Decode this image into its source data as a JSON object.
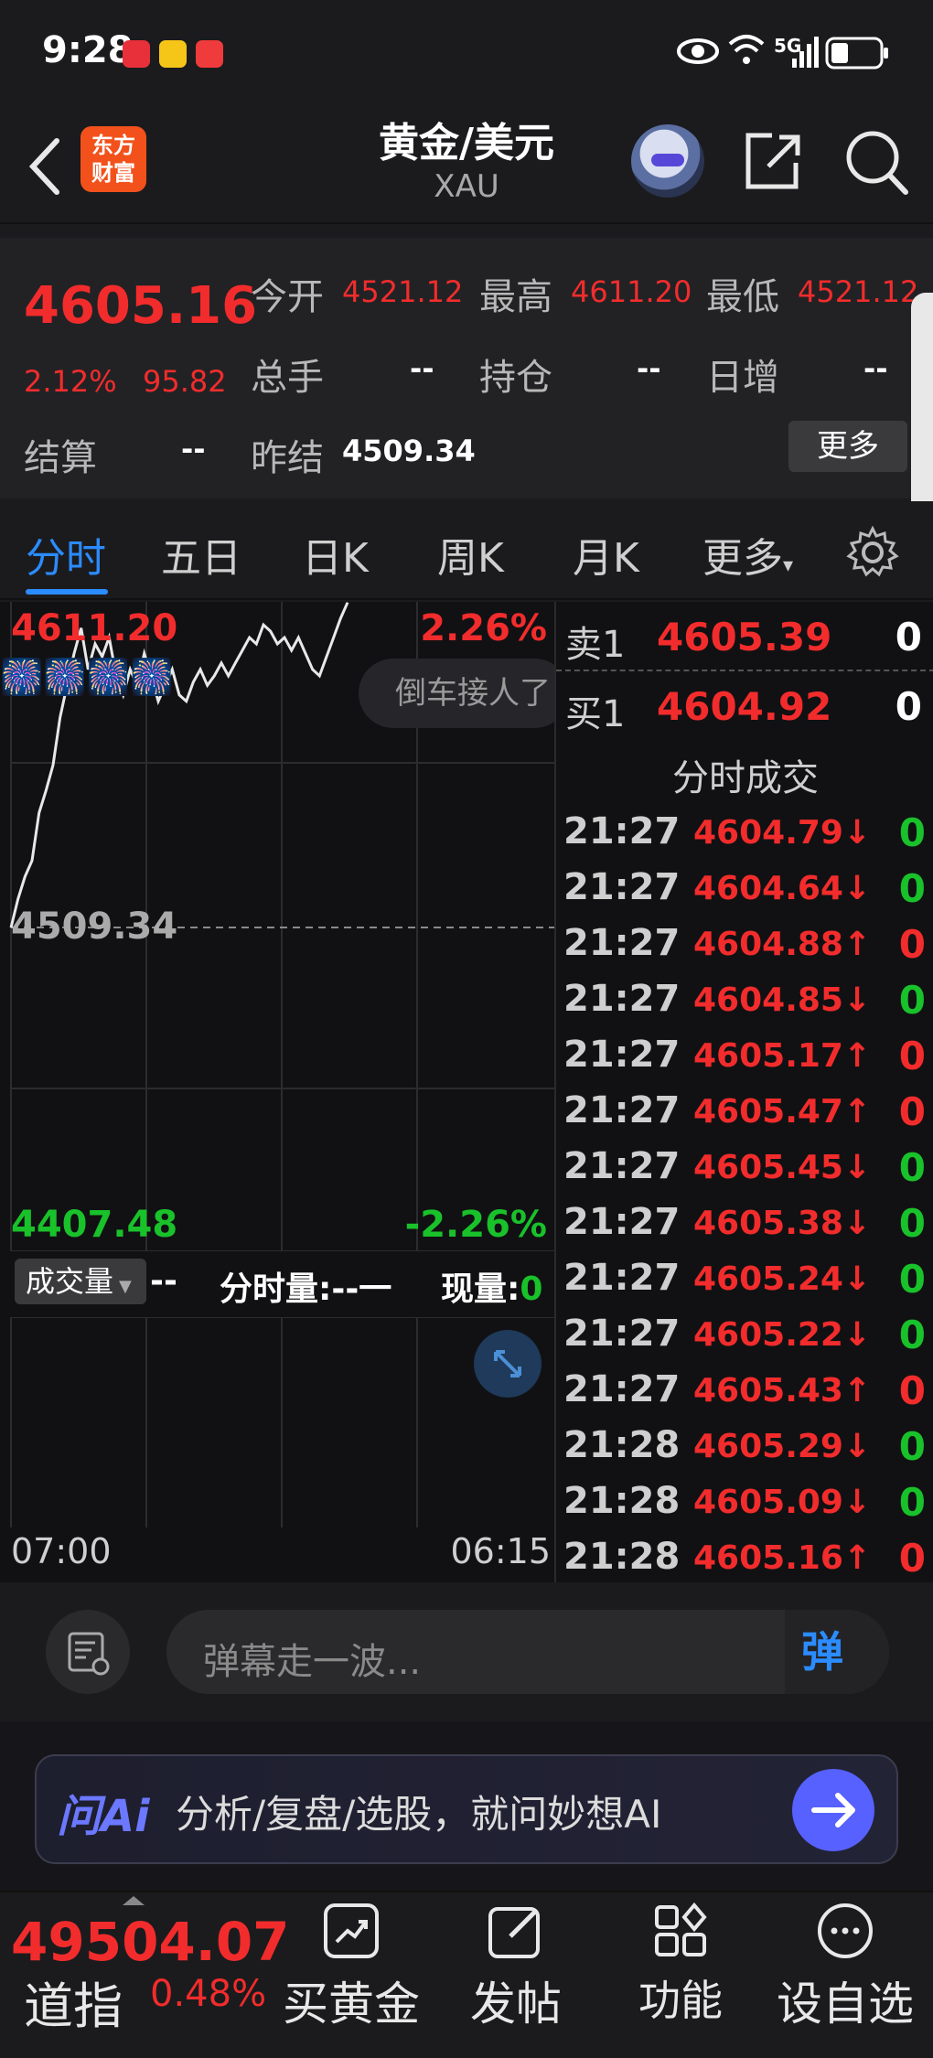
{
  "status": {
    "time": "9:28",
    "network": "5G"
  },
  "header": {
    "logo_line1": "东方",
    "logo_line2": "财富",
    "title": "黄金/美元",
    "subtitle": "XAU"
  },
  "quote": {
    "price": "4605.16",
    "change_pct": "2.12%",
    "change_abs": "95.82",
    "fields": {
      "open_label": "今开",
      "open": "4521.12",
      "high_label": "最高",
      "high": "4611.20",
      "low_label": "最低",
      "low": "4521.12",
      "volume_label": "总手",
      "volume": "--",
      "position_label": "持仓",
      "position": "--",
      "daily_inc_label": "日增",
      "daily_inc": "--",
      "settle_label": "结算",
      "settle": "--",
      "prev_settle_label": "昨结",
      "prev_settle": "4509.34"
    },
    "more_label": "更多"
  },
  "tabs": [
    "分时",
    "五日",
    "日K",
    "周K",
    "月K",
    "更多"
  ],
  "chart": {
    "top_price": "4611.20",
    "top_pct": "2.26%",
    "mid_price": "4509.34",
    "bottom_price": "4407.48",
    "bottom_pct": "-2.26%",
    "banner": "倒车接人了",
    "fireworks": "🎆🎆🎆🎆",
    "volume_selector": "成交量",
    "volume_value": "--",
    "tick_volume_label": "分时量:",
    "tick_volume_value": "--一",
    "current_volume_label": "现量:",
    "current_volume_value": "0",
    "time_start": "07:00",
    "time_end": "06:15"
  },
  "orderbook": {
    "ask_label": "卖1",
    "ask_price": "4605.39",
    "ask_vol": "0",
    "bid_label": "买1",
    "bid_price": "4604.92",
    "bid_vol": "0",
    "ticks_header": "分时成交",
    "ticks": [
      {
        "time": "21:27",
        "price": "4604.79↓",
        "vol": "0",
        "dir": "down"
      },
      {
        "time": "21:27",
        "price": "4604.64↓",
        "vol": "0",
        "dir": "down"
      },
      {
        "time": "21:27",
        "price": "4604.88↑",
        "vol": "0",
        "dir": "up"
      },
      {
        "time": "21:27",
        "price": "4604.85↓",
        "vol": "0",
        "dir": "down"
      },
      {
        "time": "21:27",
        "price": "4605.17↑",
        "vol": "0",
        "dir": "up"
      },
      {
        "time": "21:27",
        "price": "4605.47↑",
        "vol": "0",
        "dir": "up"
      },
      {
        "time": "21:27",
        "price": "4605.45↓",
        "vol": "0",
        "dir": "down"
      },
      {
        "time": "21:27",
        "price": "4605.38↓",
        "vol": "0",
        "dir": "down"
      },
      {
        "time": "21:27",
        "price": "4605.24↓",
        "vol": "0",
        "dir": "down"
      },
      {
        "time": "21:27",
        "price": "4605.22↓",
        "vol": "0",
        "dir": "down"
      },
      {
        "time": "21:27",
        "price": "4605.43↑",
        "vol": "0",
        "dir": "up"
      },
      {
        "time": "21:28",
        "price": "4605.29↓",
        "vol": "0",
        "dir": "down"
      },
      {
        "time": "21:28",
        "price": "4605.09↓",
        "vol": "0",
        "dir": "down"
      },
      {
        "time": "21:28",
        "price": "4605.16↑",
        "vol": "0",
        "dir": "up"
      }
    ]
  },
  "comment": {
    "placeholder": "弹幕走一波...",
    "send_label": "弹"
  },
  "ai": {
    "logo": "问Ai",
    "text": "分析/复盘/选股，就问妙想AI"
  },
  "bottomnav": {
    "index_value": "49504.07",
    "index_name": "道指",
    "index_change": "0.48%",
    "items": [
      "买黄金",
      "发帖",
      "功能",
      "设自选"
    ]
  },
  "colors": {
    "up": "#f22c2c",
    "down": "#19c12a",
    "accent": "#2b8cff",
    "brand": "#f2511b"
  },
  "chart_data": {
    "type": "line",
    "xlabel": "",
    "ylabel": "",
    "x_range": [
      "07:00",
      "06:15"
    ],
    "ylim": [
      4407.48,
      4611.2
    ],
    "reference": 4509.34,
    "series": [
      {
        "values": [
          4509,
          4518,
          4525,
          4530,
          4545,
          4552,
          4560,
          4575,
          4585,
          4595,
          4603,
          4590,
          4598,
          4594,
          4600,
          4588,
          4582,
          4590,
          4585,
          4595,
          4588,
          4580,
          4585,
          4590,
          4582,
          4580,
          4586,
          4590,
          4585,
          4588,
          4592,
          4588,
          4592,
          4596,
          4600,
          4598,
          4604,
          4602,
          4598,
          4600,
          4596,
          4600,
          4595,
          4590,
          4588,
          4594,
          4600,
          4606,
          4611
        ]
      }
    ]
  }
}
